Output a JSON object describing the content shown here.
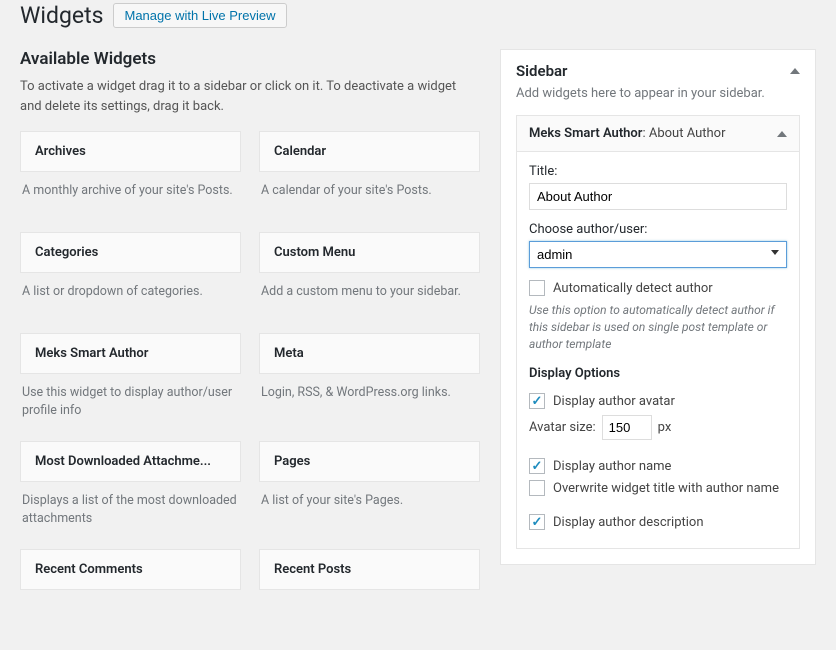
{
  "header": {
    "title": "Widgets",
    "preview_button": "Manage with Live Preview"
  },
  "available": {
    "title": "Available Widgets",
    "desc": "To activate a widget drag it to a sidebar or click on it. To deactivate a widget and delete its settings, drag it back.",
    "widgets": [
      {
        "name": "Archives",
        "desc": "A monthly archive of your site's Posts."
      },
      {
        "name": "Calendar",
        "desc": "A calendar of your site's Posts."
      },
      {
        "name": "Categories",
        "desc": "A list or dropdown of categories."
      },
      {
        "name": "Custom Menu",
        "desc": "Add a custom menu to your sidebar."
      },
      {
        "name": "Meks Smart Author",
        "desc": "Use this widget to display author/user profile info"
      },
      {
        "name": "Meta",
        "desc": "Login, RSS, & WordPress.org links."
      },
      {
        "name": "Most Downloaded Attachme...",
        "desc": "Displays a list of the most downloaded attachments"
      },
      {
        "name": "Pages",
        "desc": "A list of your site's Pages."
      },
      {
        "name": "Recent Comments",
        "desc": ""
      },
      {
        "name": "Recent Posts",
        "desc": ""
      }
    ]
  },
  "sidebar": {
    "title": "Sidebar",
    "desc": "Add widgets here to appear in your sidebar."
  },
  "config": {
    "widget_type": "Meks Smart Author",
    "widget_instance": ": About Author",
    "title_label": "Title:",
    "title_value": "About Author",
    "author_label": "Choose author/user:",
    "author_value": "admin",
    "auto_detect_label": "Automatically detect author",
    "auto_detect_help": "Use this option to automatically detect author if this sidebar is used on single post template or author template",
    "display_options_title": "Display Options",
    "display_avatar_label": "Display author avatar",
    "avatar_size_label": "Avatar size:",
    "avatar_size_value": "150",
    "avatar_size_unit": "px",
    "display_name_label": "Display author name",
    "overwrite_title_label": "Overwrite widget title with author name",
    "display_desc_label": "Display author description"
  }
}
